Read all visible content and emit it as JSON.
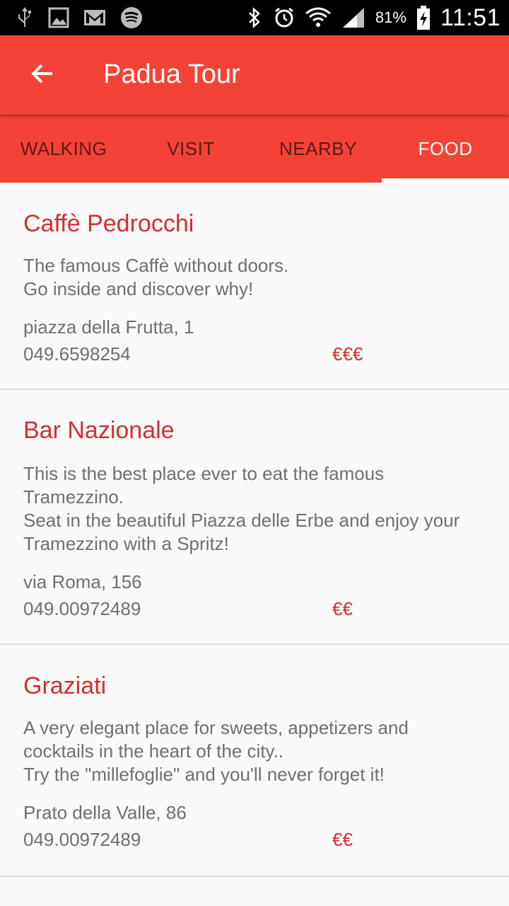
{
  "status_bar": {
    "icons_left": [
      "usb-icon",
      "image-icon",
      "gmail-icon",
      "spotify-icon"
    ],
    "icons_right": [
      "bluetooth-icon",
      "alarm-icon",
      "wifi-icon",
      "signal-icon"
    ],
    "battery_percent": "81%",
    "time": "11:51"
  },
  "app_bar": {
    "title": "Padua Tour",
    "back_icon": "arrow-back-icon"
  },
  "tabs": [
    {
      "label": "WALKING",
      "active": false
    },
    {
      "label": "VISIT",
      "active": false
    },
    {
      "label": "NEARBY",
      "active": false
    },
    {
      "label": "FOOD",
      "active": true
    }
  ],
  "places": [
    {
      "name": "Caffè Pedrocchi",
      "description": "The famous Caffè without doors.\nGo inside and discover why!",
      "address": "piazza della Frutta, 1",
      "phone": "049.6598254",
      "price": "€€€"
    },
    {
      "name": "Bar Nazionale",
      "description": "This is the best place ever to eat the famous Tramezzino.\nSeat in the beautiful Piazza delle Erbe and enjoy your Tramezzino with a Spritz!",
      "address": "via Roma, 156",
      "phone": "049.00972489",
      "price": "€€"
    },
    {
      "name": "Graziati",
      "description": "A very elegant place for sweets, appetizers and cocktails in the heart of the city..\nTry the \"millefoglie\" and you'll never forget it!",
      "address": "Prato della Valle, 86",
      "phone": "049.00972489",
      "price": "€€"
    }
  ],
  "colors": {
    "primary": "#f44336",
    "accent_text": "#d32f2f",
    "body_text": "#6f6f6f",
    "background": "#fafafa"
  }
}
